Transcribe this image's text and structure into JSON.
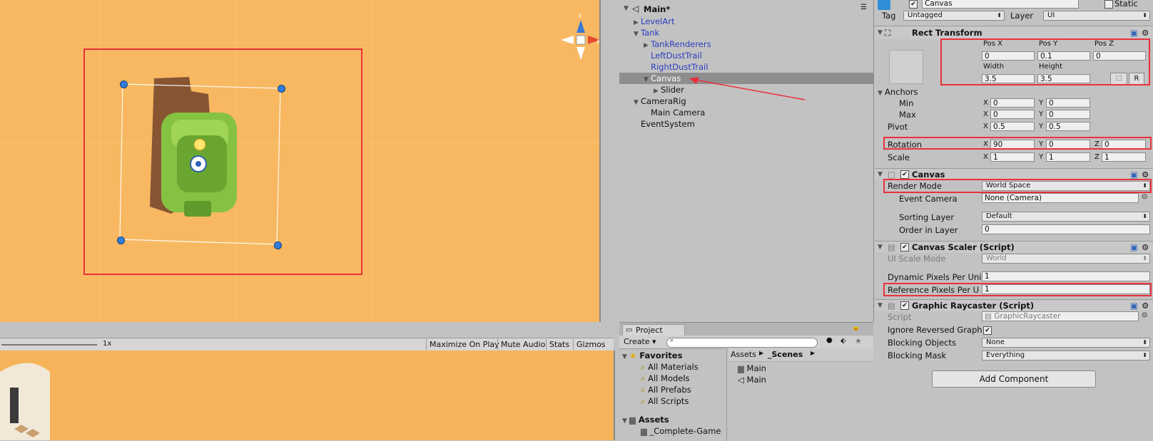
{
  "scene": {
    "gizmo_z": "z",
    "gizmo_x": "x",
    "gizmo_label": ""
  },
  "game_toolbar": {
    "zoom": "1x",
    "maximize": "Maximize On Play",
    "mute": "Mute Audio",
    "stats": "Stats",
    "gizmos": "Gizmos"
  },
  "hierarchy": {
    "root": "Main*",
    "items": [
      {
        "label": "LevelArt"
      },
      {
        "label": "Tank"
      },
      {
        "label": "TankRenderers"
      },
      {
        "label": "LeftDustTrail"
      },
      {
        "label": "RightDustTrail"
      },
      {
        "label": "Canvas"
      },
      {
        "label": "Slider"
      },
      {
        "label": "CameraRig"
      },
      {
        "label": "Main Camera"
      },
      {
        "label": "EventSystem"
      }
    ]
  },
  "project": {
    "tab": "Project",
    "create": "Create",
    "favorites": "Favorites",
    "fav_items": [
      "All Materials",
      "All Models",
      "All Prefabs",
      "All Scripts"
    ],
    "assets": "Assets",
    "asset_child": "_Complete-Game",
    "breadcrumb_root": "Assets",
    "breadcrumb_leaf": "_Scenes",
    "files": [
      "Main",
      "Main"
    ]
  },
  "inspector": {
    "name": "Canvas",
    "static": "Static",
    "tag_label": "Tag",
    "tag_value": "Untagged",
    "layer_label": "Layer",
    "layer_value": "UI",
    "rect": {
      "title": "Rect Transform",
      "posx_label": "Pos X",
      "posy_label": "Pos Y",
      "posz_label": "Pos Z",
      "posx": "0",
      "posy": "0.1",
      "posz": "0",
      "width_label": "Width",
      "height_label": "Height",
      "width": "3.5",
      "height": "3.5",
      "r_btn": "R",
      "anchors": "Anchors",
      "min": "Min",
      "max": "Max",
      "min_x": "0",
      "min_y": "0",
      "max_x": "0",
      "max_y": "0",
      "pivot": "Pivot",
      "pivot_x": "0.5",
      "pivot_y": "0.5",
      "rotation": "Rotation",
      "rot_x": "90",
      "rot_y": "0",
      "rot_z": "0",
      "scale": "Scale",
      "scale_x": "1",
      "scale_y": "1",
      "scale_z": "1",
      "x": "X",
      "y": "Y",
      "z": "Z"
    },
    "canvas": {
      "title": "Canvas",
      "render_mode_label": "Render Mode",
      "render_mode": "World Space",
      "event_camera_label": "Event Camera",
      "event_camera": "None (Camera)",
      "sorting_layer_label": "Sorting Layer",
      "sorting_layer": "Default",
      "order_label": "Order in Layer",
      "order": "0"
    },
    "scaler": {
      "title": "Canvas Scaler (Script)",
      "ui_scale_label": "UI Scale Mode",
      "ui_scale": "World",
      "dyn_label": "Dynamic Pixels Per Uni",
      "dyn": "1",
      "ref_label": "Reference Pixels Per U",
      "ref": "1"
    },
    "raycaster": {
      "title": "Graphic Raycaster (Script)",
      "script_label": "Script",
      "script": "GraphicRaycaster",
      "ignore_label": "Ignore Reversed Graph",
      "blocking_label": "Blocking Objects",
      "blocking": "None",
      "mask_label": "Blocking Mask",
      "mask": "Everything"
    },
    "add_component": "Add Component"
  },
  "colors": {
    "scene_bg": "#f7b861",
    "highlight": "#e8323c",
    "handle": "#2f7dde",
    "tank": "#86c241"
  }
}
